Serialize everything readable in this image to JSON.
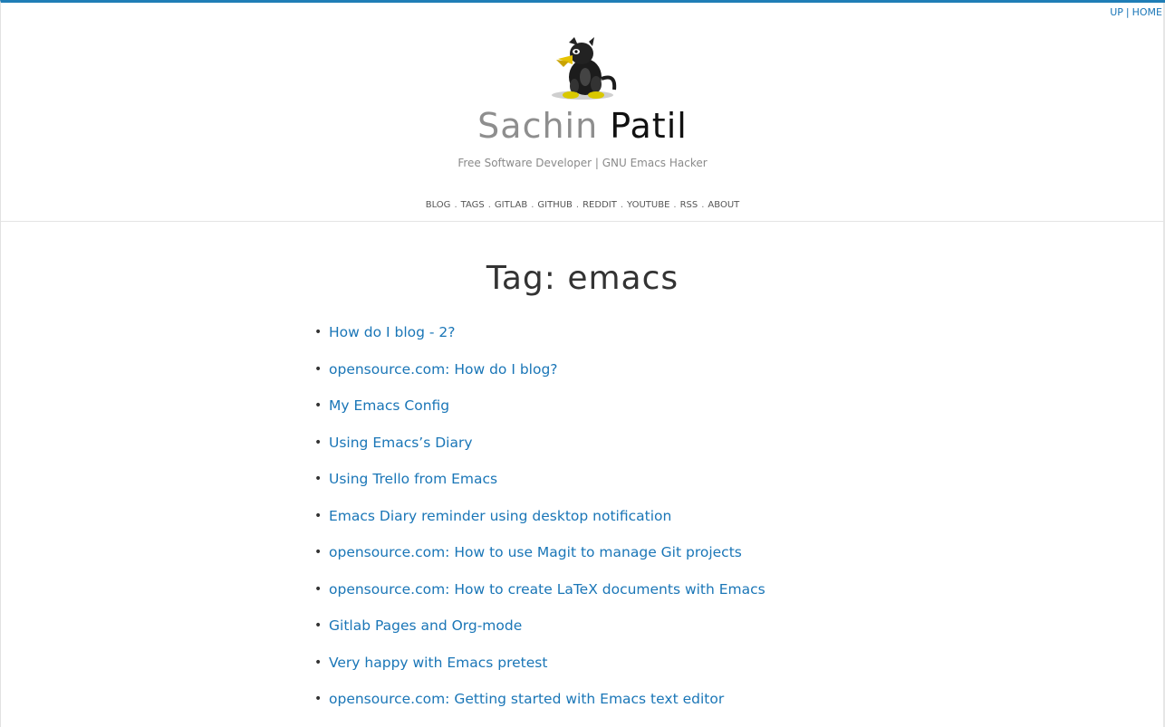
{
  "top_links": {
    "up": "UP",
    "separator": "|",
    "home": "HOME"
  },
  "site": {
    "title_first": "Sachin",
    "title_last": "Patil",
    "tagline": "Free Software Developer | GNU Emacs Hacker",
    "avatar_icon": "gnu-mascot-icon"
  },
  "nav": {
    "separator": ".",
    "items": [
      "BLOG",
      "TAGS",
      "GITLAB",
      "GITHUB",
      "REDDIT",
      "YOUTUBE",
      "RSS",
      "ABOUT"
    ]
  },
  "heading": "Tag: emacs",
  "bullet": "•",
  "posts": [
    "How do I blog - 2?",
    "opensource.com: How do I blog?",
    "My Emacs Config",
    "Using Emacs’s Diary",
    "Using Trello from Emacs",
    "Emacs Diary reminder using desktop notification",
    "opensource.com: How to use Magit to manage Git projects",
    "opensource.com: How to create LaTeX documents with Emacs",
    "Gitlab Pages and Org-mode",
    "Very happy with Emacs pretest",
    "opensource.com: Getting started with Emacs text editor"
  ],
  "colors": {
    "link": "#1a76b7",
    "accent_bar": "#1f7db6",
    "title_first": "#8e8e8e",
    "title_last": "#111111"
  }
}
